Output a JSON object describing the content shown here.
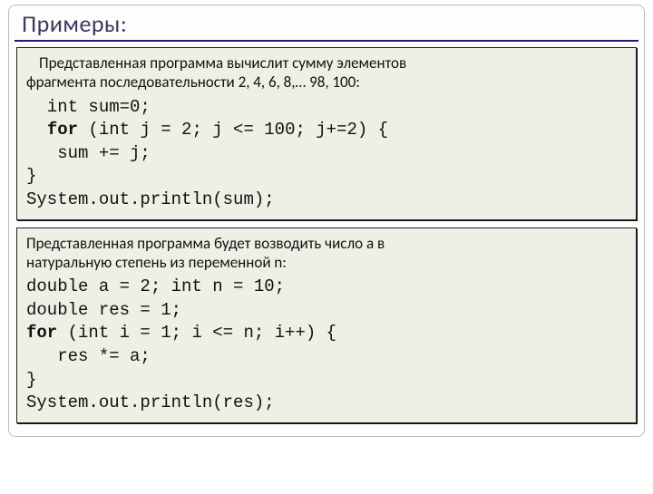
{
  "title": "Примеры:",
  "panel1": {
    "desc_line1": "Представленная программа вычислит сумму элементов",
    "desc_line2": "фрагмента последовательности 2, 4, 6, 8,… 98, 100:",
    "c1": "  int sum=0;",
    "c2a": "  ",
    "c2kw": "for",
    "c2b": " (int j = 2; j <= 100; j+=2) {",
    "c3": "   sum += j;",
    "c4": "}",
    "c5": "System.out.println(sum);"
  },
  "panel2": {
    "desc_line1": "Представленная программа будет возводить число a в",
    "desc_line2": "натуральную степень из переменной n:",
    "c1": "double a = 2; int n = 10;",
    "c2": "double res = 1;",
    "c3kw": "for",
    "c3b": " (int i = 1; i <= n; i++) {",
    "c4": "   res *= a;",
    "c5": "}",
    "c6": "System.out.println(res);"
  }
}
